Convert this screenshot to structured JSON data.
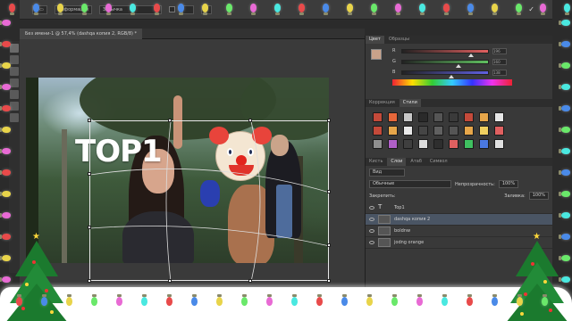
{
  "options_bar": {
    "mode_label": "Деформация",
    "mode_value": "Затычка"
  },
  "document_tab": {
    "title": "Без имени-1 @ 57,4% (dashqa копия 2, RGB/8) *"
  },
  "color_panel": {
    "tabs": [
      "Цвет",
      "Образцы"
    ],
    "active_tab": "Цвет",
    "sliders": [
      {
        "label": "R",
        "value": "196",
        "fraction": 0.77,
        "color": "#e06060"
      },
      {
        "label": "G",
        "value": "160",
        "fraction": 0.63,
        "color": "#60c060"
      },
      {
        "label": "B",
        "value": "138",
        "fraction": 0.54,
        "color": "#6060e0"
      }
    ],
    "foreground_color": "#c9a28a",
    "background_color": "#222222"
  },
  "styles_panel": {
    "tabs": [
      "Коррекция",
      "Стили"
    ],
    "active_tab": "Стили",
    "swatches": [
      "#c44a3a",
      "#e6673a",
      "#c8c8c8",
      "#2a2a2a",
      "#555555",
      "#3a3a3a",
      "#c44a3a",
      "#e6a64a",
      "#e6e6e6",
      "#c44a3a",
      "#e6a64a",
      "#e8e8e8",
      "#454545",
      "#606060",
      "#555555",
      "#e6a64a",
      "#f0d060",
      "#e06060",
      "#8f8f8f",
      "#b060c8",
      "#3f3f3f",
      "#dcdcdc",
      "#2e2e2e",
      "#e06060",
      "#3fc060",
      "#4a78e0",
      "#e0e0e0"
    ]
  },
  "layers_panel": {
    "tabs": [
      "Кисть",
      "Слои",
      "Атаб",
      "Символ"
    ],
    "active_tab": "Слои",
    "filter_label": "Вид",
    "blend_mode": "Обычные",
    "opacity_label": "Непрозрачность:",
    "opacity_value": "100%",
    "lock_label": "Закрепить:",
    "fill_label": "Заливка:",
    "fill_value": "100%",
    "layers": [
      {
        "name": "Top1",
        "type": "text",
        "selected": false
      },
      {
        "name": "dashqa копия 2",
        "type": "image",
        "selected": true
      },
      {
        "name": "boldnw",
        "type": "image",
        "selected": false
      },
      {
        "name": "jodng orange",
        "type": "image",
        "selected": false
      }
    ]
  },
  "canvas": {
    "overlay_text": "TOP1"
  },
  "colors": {
    "ui_bg": "#2b2b2b",
    "panel_bg": "#393939",
    "selected_layer": "#4a5564",
    "snow": "#ffffff",
    "tree_green": "#1b7a2e"
  }
}
